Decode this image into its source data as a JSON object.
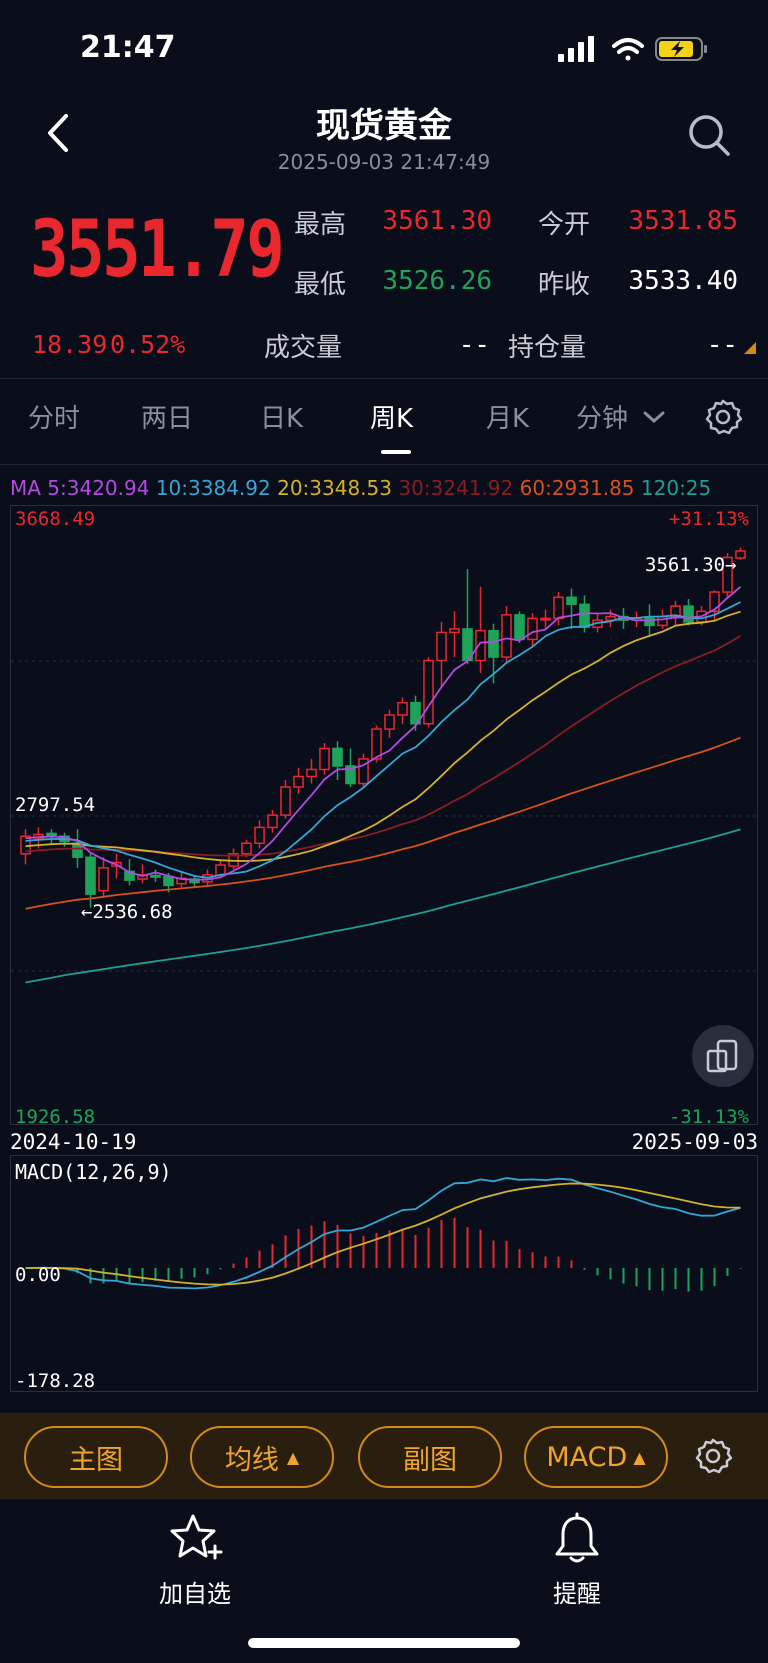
{
  "status": {
    "time": "21:47"
  },
  "header": {
    "title": "现货黄金",
    "datetime": "2025-09-03 21:47:49"
  },
  "quote": {
    "last": "3551.79",
    "change": "18.39",
    "change_pct": "0.52%",
    "high_label": "最高",
    "high": "3561.30",
    "open_label": "今开",
    "open": "3531.85",
    "low_label": "最低",
    "low": "3526.26",
    "prev_close_label": "昨收",
    "prev_close": "3533.40",
    "volume_label": "成交量",
    "volume": "--",
    "open_interest_label": "持仓量",
    "open_interest": "--"
  },
  "tabs": [
    {
      "label": "分时"
    },
    {
      "label": "两日"
    },
    {
      "label": "日K"
    },
    {
      "label": "周K"
    },
    {
      "label": "月K"
    },
    {
      "label": "分钟"
    }
  ],
  "active_tab": "周K",
  "ma": {
    "prefix": "MA",
    "ma5": "5:3420.94",
    "ma10": "10:3384.92",
    "ma20": "20:3348.53",
    "ma30": "30:3241.92",
    "ma60": "60:2931.85",
    "ma120": "120:25",
    "colors": {
      "ma5": "#b44be0",
      "ma10": "#35a7d6",
      "ma20": "#d4b12a",
      "ma30": "#8a1d22",
      "ma60": "#d8501e",
      "ma120": "#1f9e93"
    }
  },
  "chart": {
    "top_price": "3668.49",
    "top_pct": "+31.13%",
    "mid_price": "2797.54",
    "bottom_price": "1926.58",
    "bottom_pct": "-31.13%",
    "high_mark": "3561.30→",
    "low_mark": "←2536.68",
    "start_date": "2024-10-19",
    "end_date": "2025-09-03"
  },
  "macd": {
    "title": "MACD(12,26,9)",
    "zero": "0.00",
    "min": "-178.28"
  },
  "chart_data": {
    "type": "candlestick",
    "title": "",
    "ylim": [
      1926.58,
      3668.49
    ],
    "candles": [
      [
        2690,
        2740,
        2660,
        2760
      ],
      [
        2735,
        2745,
        2705,
        2765
      ],
      [
        2748,
        2740,
        2720,
        2760
      ],
      [
        2740,
        2725,
        2710,
        2750
      ],
      [
        2720,
        2680,
        2650,
        2760
      ],
      [
        2680,
        2575,
        2536.68,
        2695
      ],
      [
        2585,
        2650,
        2570,
        2680
      ],
      [
        2655,
        2665,
        2620,
        2690
      ],
      [
        2640,
        2615,
        2600,
        2675
      ],
      [
        2618,
        2630,
        2605,
        2660
      ],
      [
        2628,
        2625,
        2610,
        2645
      ],
      [
        2625,
        2600,
        2580,
        2635
      ],
      [
        2605,
        2620,
        2595,
        2640
      ],
      [
        2618,
        2608,
        2595,
        2630
      ],
      [
        2610,
        2630,
        2600,
        2645
      ],
      [
        2628,
        2658,
        2620,
        2670
      ],
      [
        2655,
        2690,
        2645,
        2705
      ],
      [
        2690,
        2720,
        2680,
        2730
      ],
      [
        2720,
        2765,
        2705,
        2785
      ],
      [
        2765,
        2800,
        2750,
        2815
      ],
      [
        2800,
        2880,
        2790,
        2900
      ],
      [
        2880,
        2910,
        2860,
        2935
      ],
      [
        2910,
        2930,
        2890,
        2960
      ],
      [
        2930,
        2990,
        2915,
        3005
      ],
      [
        2990,
        2940,
        2900,
        3010
      ],
      [
        2940,
        2890,
        2880,
        2990
      ],
      [
        2890,
        2960,
        2880,
        2975
      ],
      [
        2960,
        3045,
        2950,
        3055
      ],
      [
        3045,
        3085,
        3020,
        3100
      ],
      [
        3085,
        3120,
        3060,
        3135
      ],
      [
        3120,
        3060,
        3040,
        3140
      ],
      [
        3060,
        3240,
        3050,
        3250
      ],
      [
        3240,
        3320,
        3165,
        3350
      ],
      [
        3320,
        3330,
        3250,
        3380
      ],
      [
        3330,
        3240,
        3230,
        3500
      ],
      [
        3240,
        3325,
        3205,
        3450
      ],
      [
        3325,
        3250,
        3175,
        3345
      ],
      [
        3250,
        3370,
        3230,
        3395
      ],
      [
        3370,
        3300,
        3290,
        3380
      ],
      [
        3300,
        3360,
        3280,
        3375
      ],
      [
        3360,
        3360,
        3330,
        3385
      ],
      [
        3360,
        3420,
        3340,
        3435
      ],
      [
        3420,
        3400,
        3330,
        3445
      ],
      [
        3400,
        3335,
        3320,
        3425
      ],
      [
        3335,
        3355,
        3320,
        3375
      ],
      [
        3355,
        3365,
        3335,
        3385
      ],
      [
        3365,
        3355,
        3330,
        3390
      ],
      [
        3355,
        3360,
        3335,
        3380
      ],
      [
        3360,
        3340,
        3310,
        3400
      ],
      [
        3340,
        3365,
        3330,
        3385
      ],
      [
        3365,
        3395,
        3340,
        3410
      ],
      [
        3395,
        3350,
        3340,
        3415
      ],
      [
        3350,
        3380,
        3340,
        3395
      ],
      [
        3380,
        3435,
        3355,
        3440
      ],
      [
        3435,
        3533.4,
        3420,
        3545
      ],
      [
        3531.85,
        3551.79,
        3526.26,
        3561.3
      ]
    ]
  }
}
